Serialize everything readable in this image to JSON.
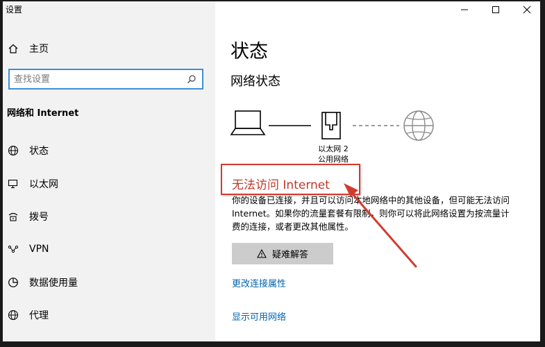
{
  "window": {
    "title": "设置"
  },
  "sidebar": {
    "home_label": "主页",
    "search_placeholder": "查找设置",
    "section_title": "网络和 Internet",
    "items": [
      {
        "label": "状态",
        "icon": "globe-icon"
      },
      {
        "label": "以太网",
        "icon": "ethernet-icon"
      },
      {
        "label": "拨号",
        "icon": "dialup-icon"
      },
      {
        "label": "VPN",
        "icon": "vpn-icon"
      },
      {
        "label": "数据使用量",
        "icon": "data-usage-icon"
      },
      {
        "label": "代理",
        "icon": "proxy-globe-icon"
      }
    ]
  },
  "main": {
    "title": "状态",
    "subtitle": "网络状态",
    "adapter_name": "以太网 2",
    "adapter_type": "公用网络",
    "status_heading": "无法访问 Internet",
    "status_description": "你的设备已连接，并且可以访问本地网络中的其他设备，但可能无法访问 Internet。如果你的流量套餐有限制，则你可以将此网络设置为按流量计费的连接，或者更改其他属性。",
    "troubleshoot_label": "疑难解答",
    "change_properties_link": "更改连接属性",
    "show_networks_link": "显示可用网络"
  },
  "colors": {
    "accent": "#0063b1",
    "search_border": "#3a8fd8",
    "warning_text": "#c0372b",
    "annotation_red": "#d23a2e"
  }
}
